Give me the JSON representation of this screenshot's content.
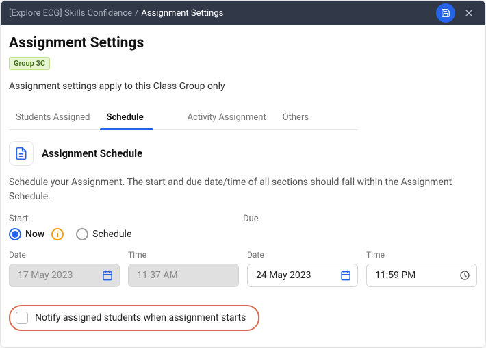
{
  "header": {
    "crumb_context": "[Explore ECG] Skills Confidence",
    "crumb_page": "Assignment Settings"
  },
  "title": "Assignment Settings",
  "group_chip": "Group 3C",
  "description": "Assignment settings apply to this Class Group only",
  "tabs": [
    {
      "label": "Students Assigned",
      "active": false
    },
    {
      "label": "Schedule",
      "active": true
    },
    {
      "label": "Activity Assignment",
      "active": false
    },
    {
      "label": "Others",
      "active": false
    }
  ],
  "schedule": {
    "section_title": "Assignment Schedule",
    "section_desc": "Schedule your Assignment. The start and due date/time of all sections should fall within the Assignment Schedule.",
    "start_label": "Start",
    "due_label": "Due",
    "radio_now": "Now",
    "radio_schedule": "Schedule",
    "date_label": "Date",
    "time_label": "Time",
    "start_date": "17 May 2023",
    "start_time": "11:37 AM",
    "due_date": "24 May 2023",
    "due_time": "11:59 PM",
    "notify_label": "Notify assigned students when assignment starts"
  }
}
